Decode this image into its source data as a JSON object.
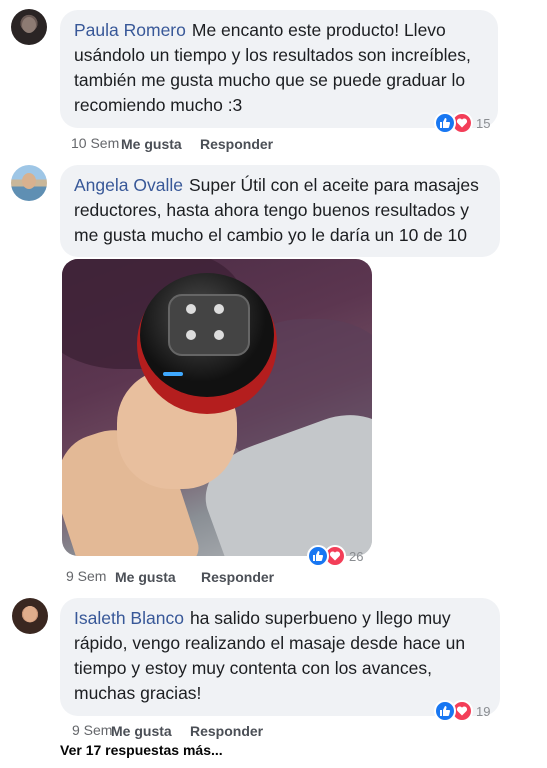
{
  "comments": [
    {
      "author": "Paula Romero",
      "text": "Me encanto este producto! Llevo usándolo un tiempo y los resultados son increíbles, también me gusta mucho que se puede graduar lo recomiendo mucho :3",
      "time": "10 Sem",
      "like_label": "Me gusta",
      "reply_label": "Responder",
      "reaction_count": "15"
    },
    {
      "author": "Angela Ovalle",
      "text": "Super Útil con el aceite para masajes reductores, hasta ahora tengo buenos resultados y me gusta mucho el cambio yo le daría un 10 de 10",
      "time": "9 Sem",
      "like_label": "Me gusta",
      "reply_label": "Responder",
      "reaction_count": "26"
    },
    {
      "author": "Isaleth Blanco",
      "text": "ha salido superbueno y llego muy rápido, vengo realizando el masaje desde hace un tiempo y estoy muy contenta con los avances, muchas gracias!",
      "time": "9 Sem",
      "like_label": "Me gusta",
      "reply_label": "Responder",
      "reaction_count": "19"
    }
  ],
  "more_replies": "Ver 17 respuestas más...",
  "colors": {
    "author": "#385898",
    "bubble": "#f0f2f5",
    "like": "#1877f2",
    "love": "#f33e58"
  },
  "icons": {
    "like": "thumbs-up-icon",
    "love": "heart-icon"
  }
}
